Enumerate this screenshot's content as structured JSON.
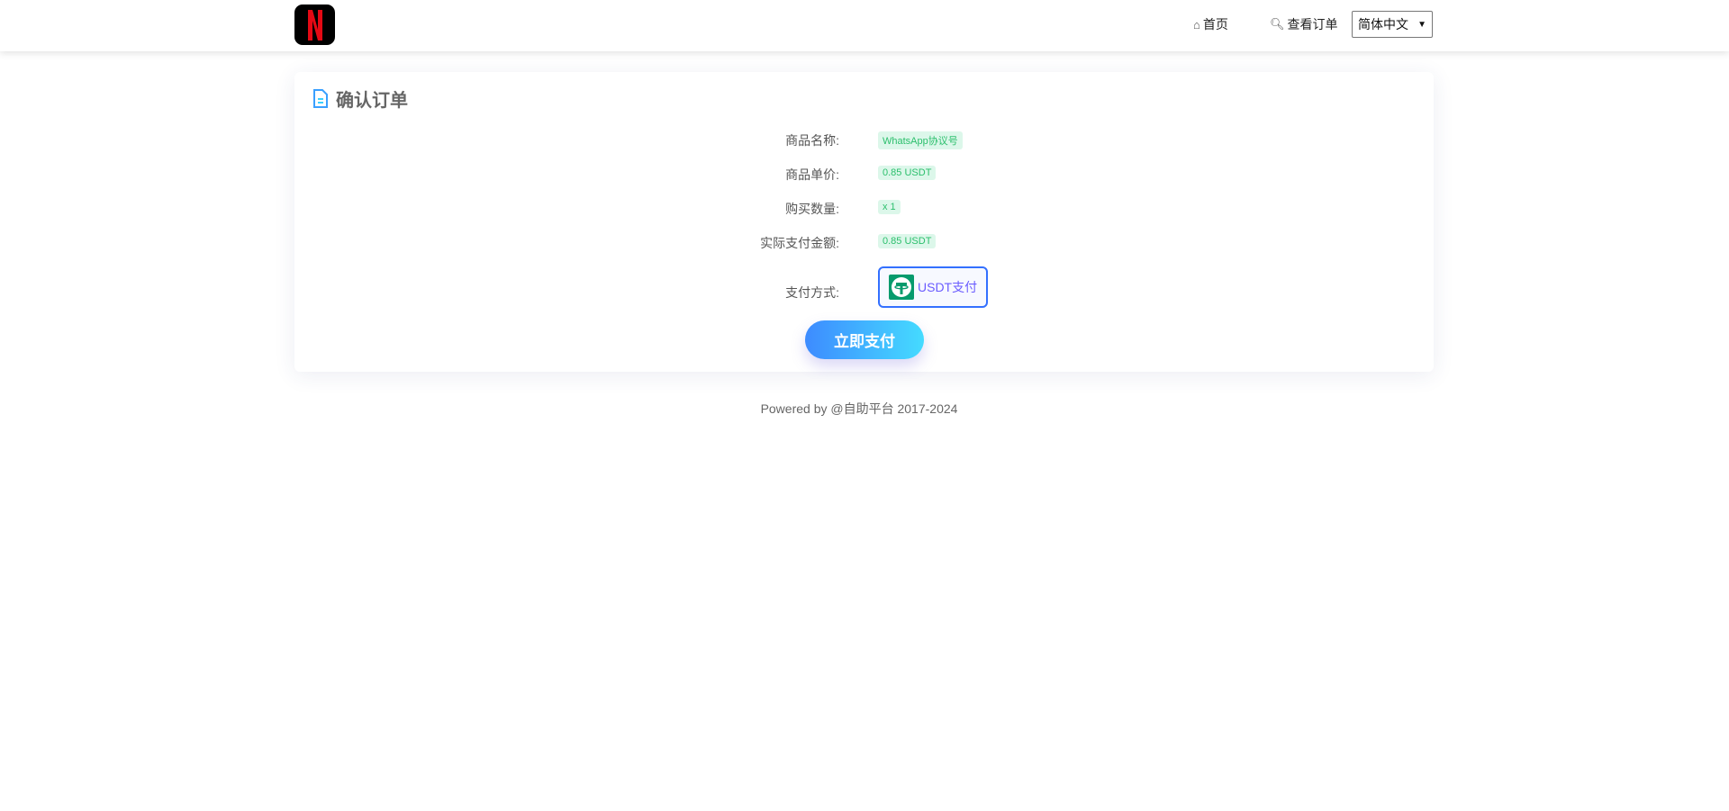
{
  "header": {
    "logo_letter": "N",
    "nav": [
      {
        "label": "首页",
        "icon": "home-icon"
      },
      {
        "label": "查看订单",
        "icon": "search-icon"
      }
    ],
    "language": "简体中文"
  },
  "order": {
    "title": "确认订单",
    "rows": [
      {
        "label": "商品名称:",
        "value": "WhatsApp协议号"
      },
      {
        "label": "商品单价:",
        "value": "0.85 USDT"
      },
      {
        "label": "购买数量:",
        "value": "x 1"
      },
      {
        "label": "实际支付金额:",
        "value": "0.85 USDT"
      }
    ],
    "payment_label": "支付方式:",
    "payment_method": "USDT支付",
    "pay_button": "立即支付"
  },
  "footer": "Powered by @自助平台 2017-2024",
  "colors": {
    "accent": "#3370ff",
    "tag_bg": "#dcf7ea",
    "tag_text": "#2bbf6c",
    "tether": "#079b6d"
  }
}
